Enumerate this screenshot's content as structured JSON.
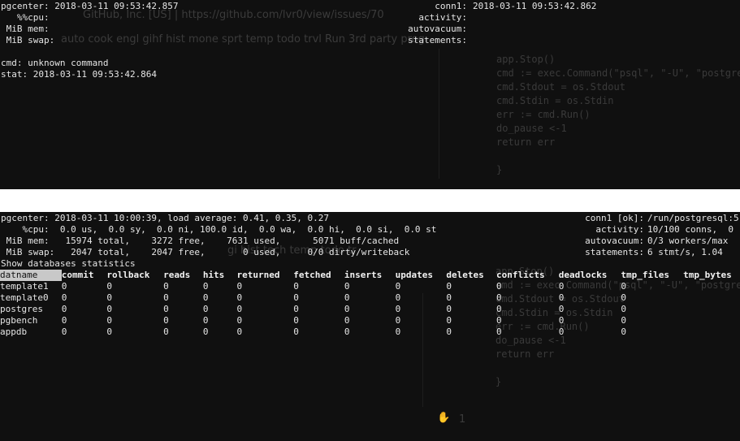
{
  "top": {
    "ghost": {
      "address_bar": "GitHub, Inc. [US]  |  https://github.com/lvr0/view/issues/70",
      "bookmarks": "auto   cook   engl   gihf   hist   mone   sprt   temp   todo   trvl   Run 3rd party prog",
      "code": "app.Stop()\ncmd := exec.Command(\"psql\", \"-U\", \"postgre\ncmd.Stdout = os.Stdout\ncmd.Stdin = os.Stdin\nerr := cmd.Run()\ndo_pause <-1\nreturn err\n\n}"
    },
    "left_lines": [
      "pgcenter: 2018-03-11 09:53:42.857",
      "   %%cpu:",
      " MiB mem:",
      " MiB swap:"
    ],
    "right_labels": [
      "conn1:",
      "activity:",
      "autovacuum:",
      "statements:"
    ],
    "right_values": [
      "2018-03-11 09:53:42.862",
      "",
      "",
      ""
    ],
    "messages": [
      "cmd: unknown command",
      "stat: 2018-03-11 09:53:42.864"
    ]
  },
  "bottom": {
    "ghost": {
      "bookmarks": "gi  hist   tech   temp   todo   tr",
      "code": "app.Stop()\ncmd := exec.Command(\"psql\", \"-U\", \"postgre\ncmd.Stdout = os.Stdout\ncmd.Stdin = os.Stdin\nerr := cmd.Run()\ndo_pause <-1\nreturn err\n\n}",
      "reaction": "1"
    },
    "header_lines": [
      "pgcenter: 2018-03-11 10:00:39, load average: 0.41, 0.35, 0.27",
      "    %cpu:  0.0 us,  0.0 sy,  0.0 ni, 100.0 id,  0.0 wa,  0.0 hi,  0.0 si,  0.0 st",
      " MiB mem:   15974 total,    3272 free,    7631 used,      5071 buff/cached",
      " MiB swap:   2047 total,    2047 free,       0 used,     0/0 dirty/writeback"
    ],
    "right_labels": [
      "conn1 [ok]:",
      "activity:",
      "autovacuum:",
      "statements:"
    ],
    "right_values": [
      "/run/postgresql:5",
      "10/100 conns,  0",
      "0/3 workers/max",
      "6 stmt/s, 1.04"
    ],
    "section_title": "Show databases statistics",
    "columns": [
      "datname",
      "commit",
      "rollback",
      "reads",
      "hits",
      "returned",
      "fetched",
      "inserts",
      "updates",
      "deletes",
      "conflicts",
      "deadlocks",
      "tmp_files",
      "tmp_bytes"
    ],
    "rows": [
      [
        "template1",
        "0",
        "0",
        "0",
        "0",
        "0",
        "0",
        "0",
        "0",
        "0",
        "0",
        "0",
        "0",
        ""
      ],
      [
        "template0",
        "0",
        "0",
        "0",
        "0",
        "0",
        "0",
        "0",
        "0",
        "0",
        "0",
        "0",
        "0",
        ""
      ],
      [
        "postgres",
        "0",
        "0",
        "0",
        "0",
        "0",
        "0",
        "0",
        "0",
        "0",
        "0",
        "0",
        "0",
        ""
      ],
      [
        "pgbench",
        "0",
        "0",
        "0",
        "0",
        "0",
        "0",
        "0",
        "0",
        "0",
        "0",
        "0",
        "0",
        ""
      ],
      [
        "appdb",
        "0",
        "0",
        "0",
        "0",
        "0",
        "0",
        "0",
        "0",
        "0",
        "0",
        "0",
        "0",
        ""
      ]
    ]
  }
}
